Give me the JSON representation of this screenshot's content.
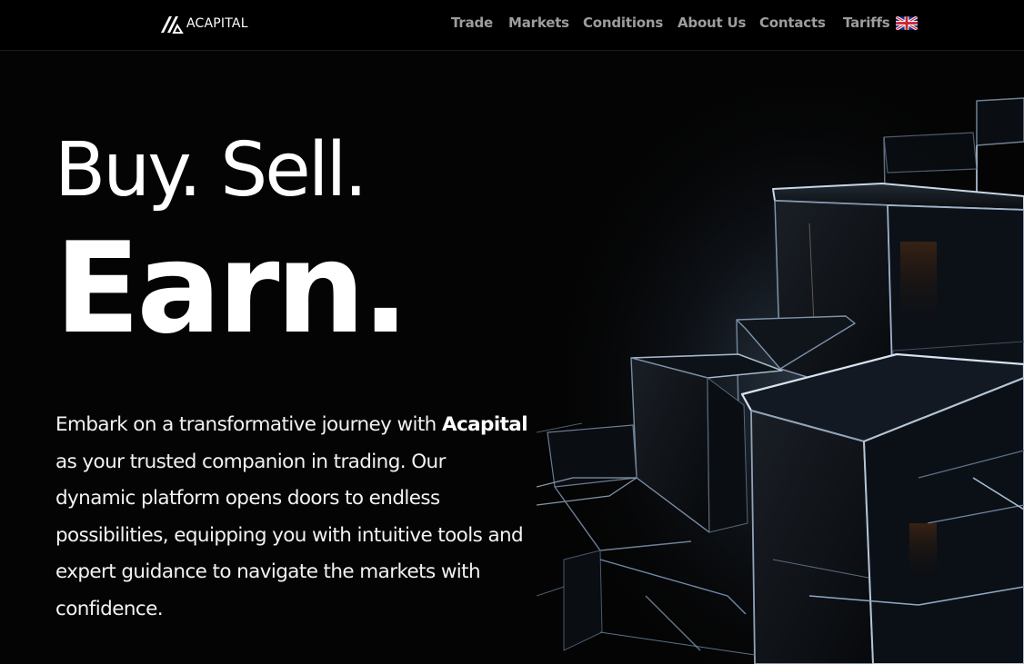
{
  "header": {
    "logo_text": "ACAPITAL",
    "nav": [
      {
        "id": "trade",
        "label": "Trade"
      },
      {
        "id": "markets",
        "label": "Markets"
      },
      {
        "id": "conditions",
        "label": "Conditions"
      },
      {
        "id": "about",
        "label": "About Us"
      },
      {
        "id": "contacts",
        "label": "Contacts"
      },
      {
        "id": "tariffs",
        "label": "Tariffs"
      }
    ],
    "language_flag": "uk-flag-icon"
  },
  "hero": {
    "headline_line1": "Buy. Sell.",
    "headline_line2": "Earn.",
    "intro_prefix": "Embark on a transformative journey with ",
    "intro_brand": "Acapital",
    "intro_suffix": " as your trusted companion in trading. Our dynamic platform opens doors to endless possibilities, equipping you with intuitive tools and expert guidance to navigate the markets with confidence."
  },
  "colors": {
    "background": "#040404",
    "nav_text": "#9d9d9d",
    "headline": "#ffffff",
    "body_text": "#f2f2f2"
  }
}
